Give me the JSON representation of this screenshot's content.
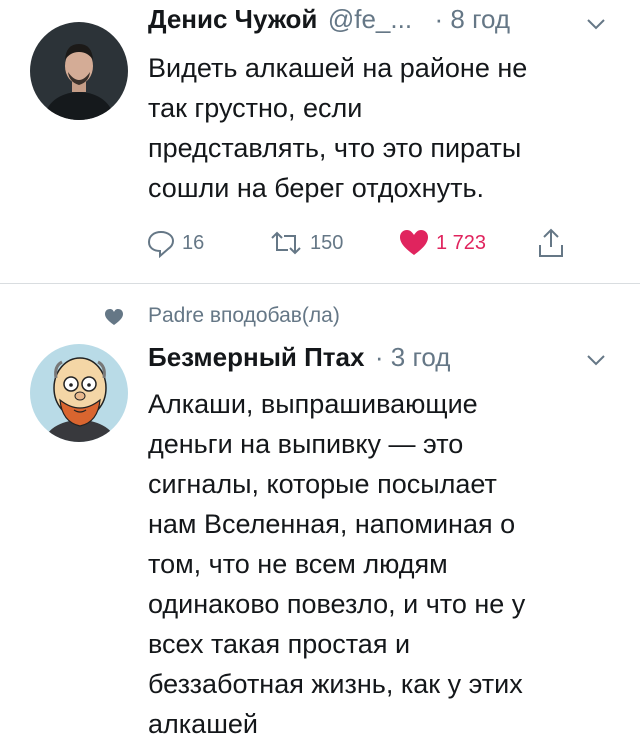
{
  "tweet1": {
    "author_name": "Денис Чужой",
    "handle": "@fe_...",
    "time": "· 8 год",
    "text": "Видеть алкашей на районе не\nтак грустно, если\nпредставлять, что это пираты\nсошли на берег отдохнуть.",
    "reply_count": "16",
    "retweet_count": "150",
    "like_count": "1 723"
  },
  "context": {
    "text": "Padre вподобав(ла)"
  },
  "tweet2": {
    "author_name": "Безмерный Птах",
    "time": "· 3 год",
    "text": "Алкаши, выпрашивающие\nденьги на выпивку — это\nсигналы, которые посылает\nнам Вселенная, напоминая о\nтом, что не всем людям\nодинаково повезло, и что не у\nвсех такая простая и\nбеззаботная жизнь, как у этих\nалкашей"
  },
  "colors": {
    "like": "#e0245e",
    "muted": "#657786",
    "text": "#14171a"
  }
}
